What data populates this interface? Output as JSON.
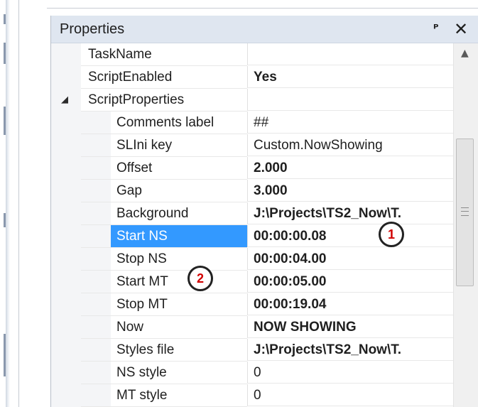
{
  "panel": {
    "title": "Properties",
    "pin_icon": "pin-icon",
    "close_icon": "close-icon"
  },
  "rows": [
    {
      "name": "TaskName",
      "value": "",
      "level": 0,
      "bold": false
    },
    {
      "name": "ScriptEnabled",
      "value": "Yes",
      "level": 0,
      "bold": true
    },
    {
      "name": "ScriptProperties",
      "value": "",
      "level": 0,
      "bold": false,
      "expander": "◢"
    },
    {
      "name": "Comments label",
      "value": "##",
      "level": 1,
      "bold": false
    },
    {
      "name": "SLIni key",
      "value": "Custom.NowShowing",
      "level": 1,
      "bold": false
    },
    {
      "name": "Offset",
      "value": "2.000",
      "level": 1,
      "bold": true
    },
    {
      "name": "Gap",
      "value": "3.000",
      "level": 1,
      "bold": true
    },
    {
      "name": "Background",
      "value": "J:\\Projects\\TS2_Now\\T.",
      "level": 1,
      "bold": true
    },
    {
      "name": "Start NS",
      "value": "00:00:00.08",
      "level": 1,
      "bold": true,
      "selected": true
    },
    {
      "name": "Stop NS",
      "value": "00:00:04.00",
      "level": 1,
      "bold": true
    },
    {
      "name": "Start MT",
      "value": "00:00:05.00",
      "level": 1,
      "bold": true
    },
    {
      "name": "Stop MT",
      "value": "00:00:19.04",
      "level": 1,
      "bold": true
    },
    {
      "name": "Now",
      "value": "NOW SHOWING",
      "level": 1,
      "bold": true
    },
    {
      "name": "Styles file",
      "value": "J:\\Projects\\TS2_Now\\T.",
      "level": 1,
      "bold": true
    },
    {
      "name": "NS style",
      "value": "0",
      "level": 1,
      "bold": false
    },
    {
      "name": "MT style",
      "value": "0",
      "level": 1,
      "bold": false
    }
  ],
  "scrollbar": {
    "up_arrow": "▲",
    "thumb_grip_icon": "grip-icon"
  },
  "callouts": {
    "one": "1",
    "two": "2"
  },
  "colors": {
    "title_bg": "#dfe6f0",
    "selection": "#3399ff",
    "callout_number": "#d10000"
  }
}
